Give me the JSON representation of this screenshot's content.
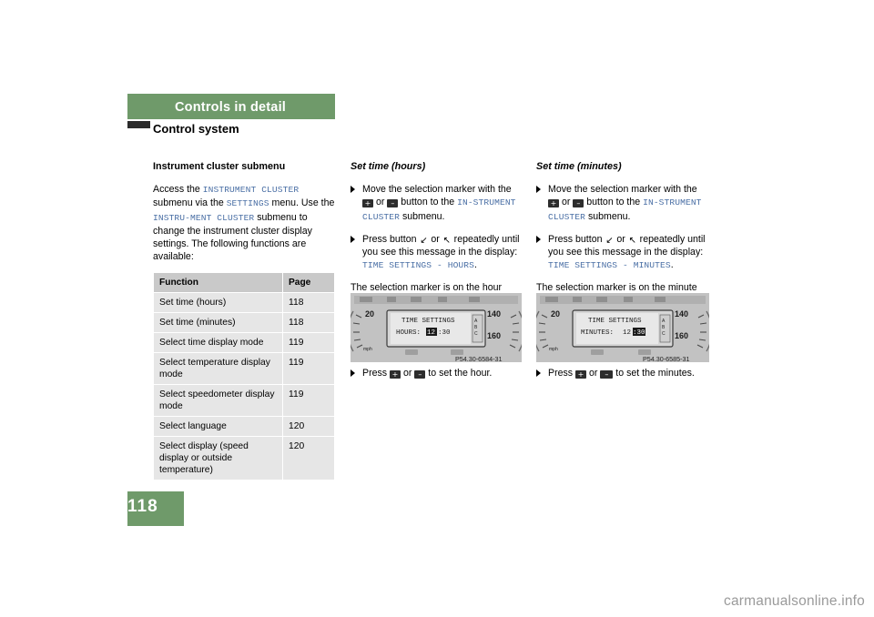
{
  "header": {
    "band_title": "Controls in detail",
    "subhead": "Control system"
  },
  "page_number": "118",
  "column1": {
    "title": "Instrument cluster submenu",
    "para1_a": "Access the ",
    "para1_mono1": "INSTRUMENT CLUSTER",
    "para1_b": " submenu via the ",
    "para1_mono2": "SETTINGS",
    "para1_c": " menu. Use the ",
    "para1_mono3": "INSTRU-MENT CLUSTER",
    "para1_d": " submenu to change the instrument cluster display settings. The following functions are available:",
    "table": {
      "headers": [
        "Function",
        "Page"
      ],
      "rows": [
        [
          "Set time (hours)",
          "118"
        ],
        [
          "Set time (minutes)",
          "118"
        ],
        [
          "Select time display mode",
          "119"
        ],
        [
          "Select temperature display mode",
          "119"
        ],
        [
          "Select speedometer display mode",
          "119"
        ],
        [
          "Select language",
          "120"
        ],
        [
          "Select display (speed display or outside temperature)",
          "120"
        ]
      ]
    }
  },
  "column2": {
    "title": "Set time (hours)",
    "bullet1_a": "Move the selection marker with the ",
    "bullet1_b": " or ",
    "bullet1_c": " button to the ",
    "bullet1_mono": "IN-STRUMENT CLUSTER",
    "bullet1_d": " submenu.",
    "bullet2_a": "Press button ",
    "bullet2_b": " or ",
    "bullet2_c": " repeatedly until you see this message in the display: ",
    "bullet2_mono": "TIME SETTINGS - HOURS",
    "bullet2_d": ".",
    "para_after": "The selection marker is on the hour setting.",
    "bullet3_a": "Press ",
    "bullet3_b": " or ",
    "bullet3_c": " to set the hour.",
    "figure": {
      "caption": "P54.30-6584-31",
      "display_line1": "TIME SETTINGS",
      "display_line2_label": "HOURS:",
      "display_line2_value": "12",
      "display_line2_value2": "30",
      "speed_top": "20",
      "speed_unit": "mph",
      "speed_right_top": "140",
      "speed_right_bottom": "160"
    }
  },
  "column3": {
    "title": "Set time (minutes)",
    "bullet1_a": "Move the selection marker with the ",
    "bullet1_b": " or ",
    "bullet1_c": " button to the ",
    "bullet1_mono": "IN-STRUMENT CLUSTER",
    "bullet1_d": " submenu.",
    "bullet2_a": "Press button ",
    "bullet2_b": " or ",
    "bullet2_c": " repeatedly until you see this message in the display: ",
    "bullet2_mono": "TIME SETTINGS - MINUTES",
    "bullet2_d": ".",
    "para_after": "The selection marker is on the minute setting.",
    "bullet3_a": "Press ",
    "bullet3_b": " or ",
    "bullet3_c": " to set the minutes.",
    "figure": {
      "caption": "P54.30-6585-31",
      "display_line1": "TIME SETTINGS",
      "display_line2_label": "MINUTES:",
      "display_line2_value": "12",
      "display_line2_value2": "30",
      "speed_top": "20",
      "speed_unit": "mph",
      "speed_right_top": "140",
      "speed_right_bottom": "160"
    }
  },
  "glyphs": {
    "plus": "+",
    "minus": "–",
    "up": "↖",
    "down": "↙"
  },
  "watermark": {
    "text": "carmanualsonline.info"
  },
  "colors": {
    "brand_green": "#6f9a6a",
    "mono_blue": "#4a6fa5",
    "table_header": "#c9c9c9",
    "table_cell": "#e6e6e6"
  }
}
